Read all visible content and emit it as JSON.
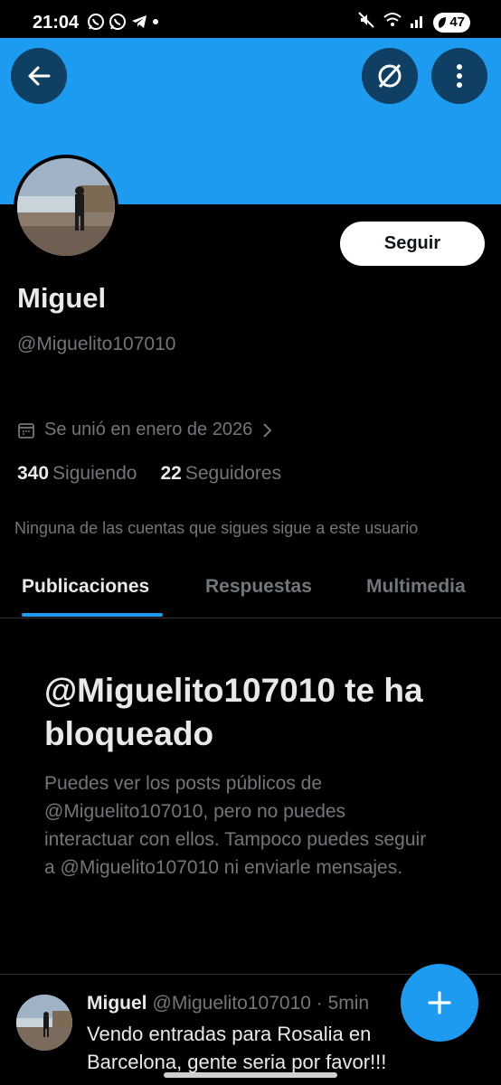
{
  "status_bar": {
    "time": "21:04",
    "app_icons": [
      "whatsapp-icon",
      "whatsapp-icon",
      "telegram-icon"
    ],
    "battery": "47"
  },
  "header": {
    "banner_color": "#1d9bf0",
    "back_icon": "arrow-left-icon",
    "grok_icon": "grok-icon",
    "more_icon": "more-vertical-icon"
  },
  "profile": {
    "follow_label": "Seguir",
    "name": "Miguel",
    "handle": "@Miguelito107010",
    "joined": "Se unió en enero de 2026",
    "following_count": "340",
    "following_label": "Siguiendo",
    "followers_count": "22",
    "followers_label": "Seguidores",
    "mutuals_note": "Ninguna de las cuentas que sigues sigue a este usuario"
  },
  "tabs": [
    {
      "label": "Publicaciones",
      "active": true
    },
    {
      "label": "Respuestas",
      "active": false
    },
    {
      "label": "Multimedia",
      "active": false
    }
  ],
  "blocked": {
    "title": "@Miguelito107010 te ha bloqueado",
    "description": "Puedes ver los posts públicos de @Miguelito107010, pero no puedes interactuar con ellos. Tampoco puedes seguir a @Miguelito107010 ni enviarle mensajes."
  },
  "post": {
    "name": "Miguel",
    "meta": "@Miguelito107010 · 5min",
    "text": "Vendo entradas para Rosalia en Barcelona, gente seria por favor!!!"
  },
  "colors": {
    "accent": "#1d9bf0",
    "muted_text": "#71767b",
    "primary_text": "#e7e9ea"
  }
}
